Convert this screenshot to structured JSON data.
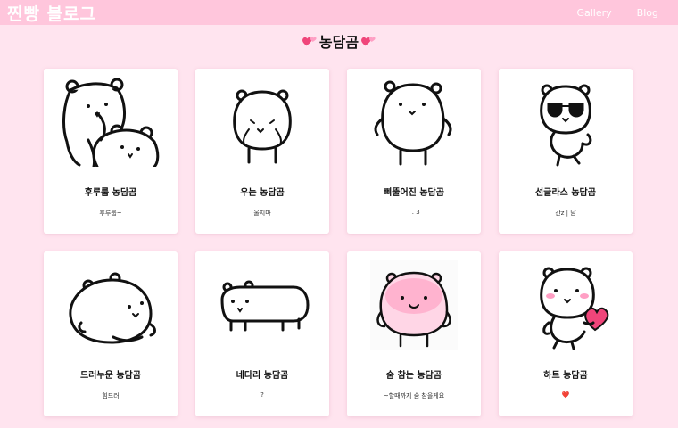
{
  "nav": {
    "brand": "찐빵 블로그",
    "links": [
      "Gallery",
      "Blog"
    ]
  },
  "page": {
    "title": "농담곰"
  },
  "cards": [
    {
      "title": "후루룹 농담곰",
      "desc": "후루룹~",
      "icon": "two-bears-hugging"
    },
    {
      "title": "우는 농담곰",
      "desc": "울지마",
      "icon": "crying-bear"
    },
    {
      "title": "삐뚤어진 농담곰",
      "desc": ". . 3",
      "icon": "tilted-bear"
    },
    {
      "title": "선글라스 농담곰",
      "desc": "간z | 남",
      "icon": "sunglasses-bear"
    },
    {
      "title": "드러누운 농담곰",
      "desc": "힘드러",
      "icon": "lying-bear"
    },
    {
      "title": "네다리 농담곰",
      "desc": "?",
      "icon": "four-legged-bear"
    },
    {
      "title": "숨 참는 농담곰",
      "desc": "~할때까지 숨 참을게요",
      "icon": "holding-breath-bear"
    },
    {
      "title": "하트 농담곰",
      "desc": "❤️",
      "icon": "heart-bear"
    }
  ],
  "colors": {
    "navbar": "#ffc6dc",
    "background": "#ffe4ef",
    "blush": "#ff9fc4",
    "heart": "#f0457a"
  }
}
